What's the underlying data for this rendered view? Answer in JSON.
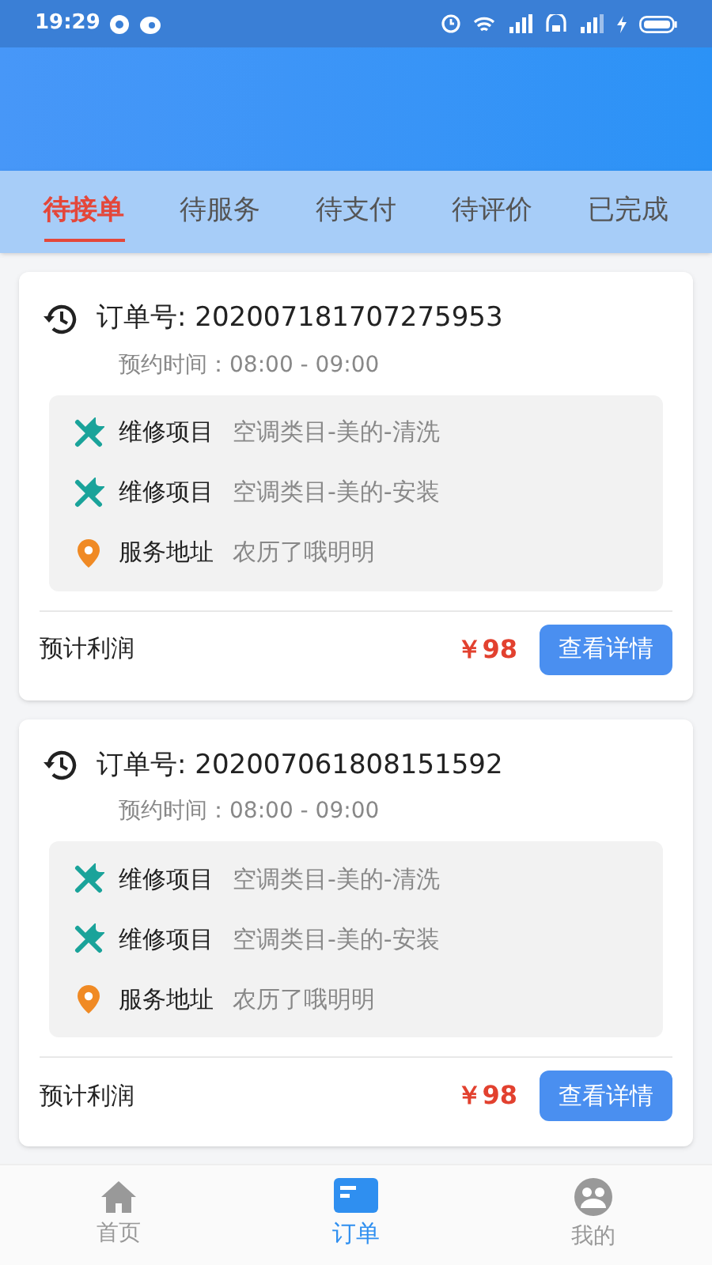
{
  "status_bar": {
    "time": "19:29"
  },
  "tabs": [
    {
      "label": "待接单",
      "selected": true
    },
    {
      "label": "待服务",
      "selected": false
    },
    {
      "label": "待支付",
      "selected": false
    },
    {
      "label": "待评价",
      "selected": false
    },
    {
      "label": "已完成",
      "selected": false
    }
  ],
  "orders": [
    {
      "order_no": "订单号: 202007181707275953",
      "appointment": "预约时间：08:00 - 09:00",
      "items": [
        {
          "kind": "repair",
          "label": "维修项目",
          "value": "空调类目-美的-清洗"
        },
        {
          "kind": "repair",
          "label": "维修项目",
          "value": "空调类目-美的-安装"
        },
        {
          "kind": "address",
          "label": "服务地址",
          "value": "农历了哦明明"
        }
      ],
      "profit_label": "预计利润",
      "profit": "￥98",
      "button": "查看详情"
    },
    {
      "order_no": "订单号: 202007061808151592",
      "appointment": "预约时间：08:00 - 09:00",
      "items": [
        {
          "kind": "repair",
          "label": "维修项目",
          "value": "空调类目-美的-清洗"
        },
        {
          "kind": "repair",
          "label": "维修项目",
          "value": "空调类目-美的-安装"
        },
        {
          "kind": "address",
          "label": "服务地址",
          "value": "农历了哦明明"
        }
      ],
      "profit_label": "预计利润",
      "profit": "￥98",
      "button": "查看详情"
    }
  ],
  "bottom_nav": [
    {
      "kind": "home",
      "label": "首页",
      "selected": false
    },
    {
      "kind": "orders",
      "label": "订单",
      "selected": true
    },
    {
      "kind": "profile",
      "label": "我的",
      "selected": false
    }
  ]
}
